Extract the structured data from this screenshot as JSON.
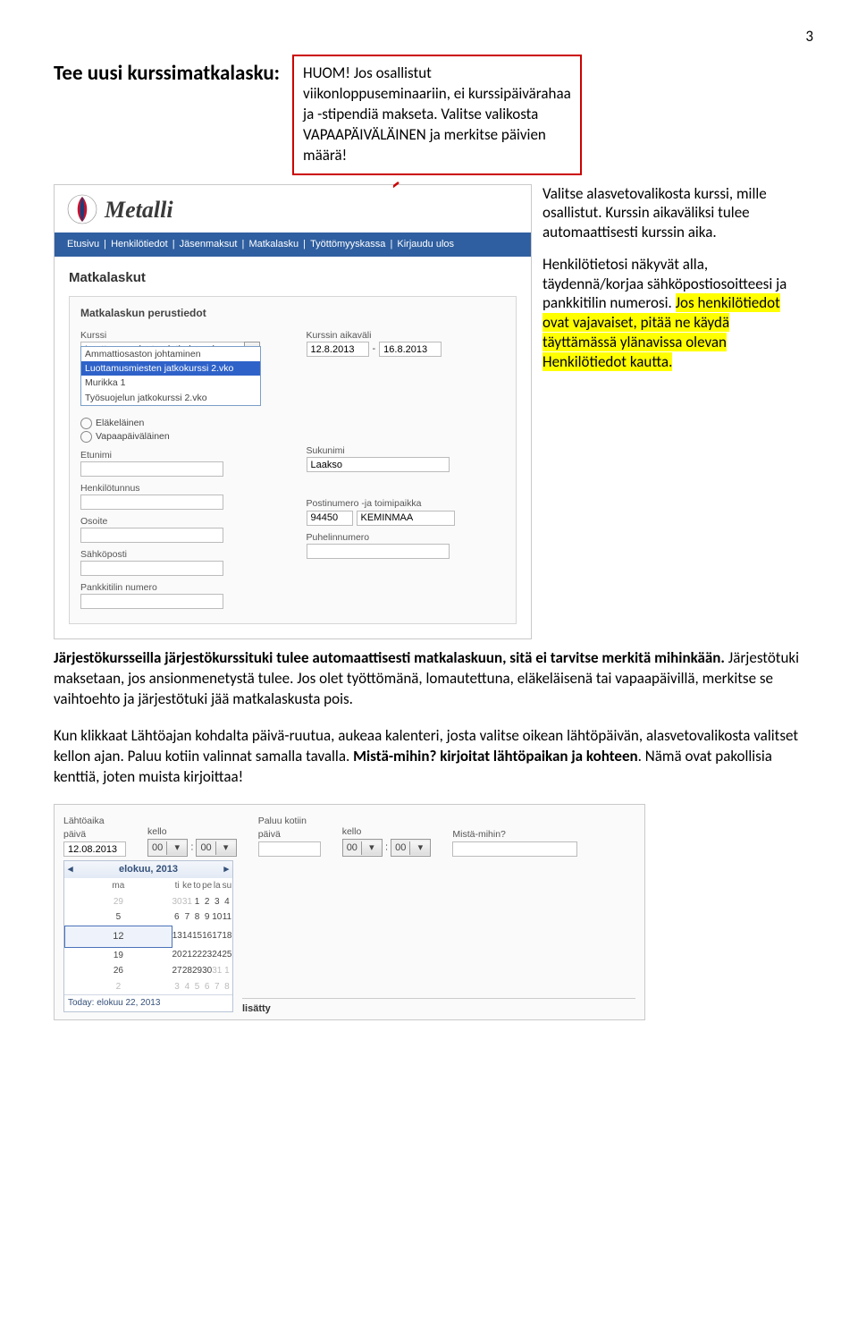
{
  "page_number": "3",
  "heading": "Tee uusi kurssimatkalasku:",
  "note_box": "HUOM! Jos osallistut viikonloppuseminaariin, ei kurssipäivärahaa ja -stipendiä makseta. Valitse valikosta VAPAAPÄIVÄLÄINEN ja merkitse päivien määrä!",
  "screenshot1": {
    "logo_text": "Metalli",
    "nav": [
      "Etusivu",
      "Henkilötiedot",
      "Jäsenmaksut",
      "Matkalasku",
      "Työttömyyskassa",
      "Kirjaudu ulos"
    ],
    "page_title": "Matkalaskut",
    "card_title": "Matkalaskun perustiedot",
    "labels": {
      "kurssi": "Kurssi",
      "aikavali": "Kurssin aikaväli",
      "etunimi": "Etunimi",
      "sukunimi": "Sukunimi",
      "hetu": "Henkilötunnus",
      "osoite": "Osoite",
      "postinro": "Postinumero -ja toimipaikka",
      "email": "Sähköposti",
      "puh": "Puhelinnumero",
      "tili": "Pankkitilin numero"
    },
    "selected_course": "Luottamusmiesten jatkokurssi 2.vko",
    "course_options": [
      "Ammattiosaston johtaminen",
      "Luottamusmiesten jatkokurssi 2.vko",
      "Murikka 1",
      "Työsuojelun jatkokurssi 2.vko"
    ],
    "radios": [
      "Eläkeläinen",
      "Vapaapäiväläinen"
    ],
    "date_from": "12.8.2013",
    "date_to": "16.8.2013",
    "sukunimi_value": "Laakso",
    "post1": "94450",
    "post2": "KEMINMAA"
  },
  "side_paragraphs": {
    "p1": "Valitse alasvetovalikosta kurssi, mille osallistut. Kurssin aikaväliksi tulee automaattisesti kurssin aika.",
    "p2a": "Henkilötietosi näkyvät alla, täydennä/korjaa sähköpostiosoitteesi ja pankkitilin numerosi. ",
    "p2_hl": "Jos henkilötiedot ovat vajavaiset, pitää ne käydä täyttämässä ylänavissa olevan Henkilötiedot kautta."
  },
  "body": {
    "p3a": "Järjestökursseilla järjestökurssituki tulee automaattisesti matkalaskuun, sitä ei tarvitse merkitä mihinkään.",
    "p3b": " Järjestötuki maksetaan, jos ansionmenetystä tulee. Jos olet työttömänä, lomautettuna, eläkeläisenä tai vapaapäivillä, merkitse se vaihtoehto ja järjestötuki jää matkalaskusta pois.",
    "p4a": "Kun klikkaat Lähtöajan kohdalta päivä-ruutua, aukeaa kalenteri, josta valitse oikean lähtöpäivän, alasvetovalikosta valitset kellon ajan. Paluu kotiin valinnat samalla tavalla. ",
    "p4b": "Mistä-mihin? kirjoitat lähtöpaikan ja kohteen",
    "p4c": ". Nämä ovat pakollisia kenttiä, joten muista kirjoittaa!"
  },
  "shot2": {
    "labels": {
      "lahtoaika": "Lähtöaika",
      "paiva": "päivä",
      "kello": "kello",
      "paluu": "Paluu kotiin",
      "mista": "Mistä-mihin?",
      "lisatty": "lisätty"
    },
    "date_value": "12.08.2013",
    "time_hh": "00",
    "time_mm": "00",
    "cal": {
      "month": "elokuu, 2013",
      "dow": [
        "ma",
        "ti",
        "ke",
        "to",
        "pe",
        "la",
        "su"
      ],
      "rows": [
        [
          "29",
          "30",
          "31",
          "1",
          "2",
          "3",
          "4"
        ],
        [
          "5",
          "6",
          "7",
          "8",
          "9",
          "10",
          "11"
        ],
        [
          "12",
          "13",
          "14",
          "15",
          "16",
          "17",
          "18"
        ],
        [
          "19",
          "20",
          "21",
          "22",
          "23",
          "24",
          "25"
        ],
        [
          "26",
          "27",
          "28",
          "29",
          "30",
          "31",
          "1"
        ],
        [
          "2",
          "3",
          "4",
          "5",
          "6",
          "7",
          "8"
        ]
      ],
      "today": "Today: elokuu 22, 2013"
    }
  }
}
